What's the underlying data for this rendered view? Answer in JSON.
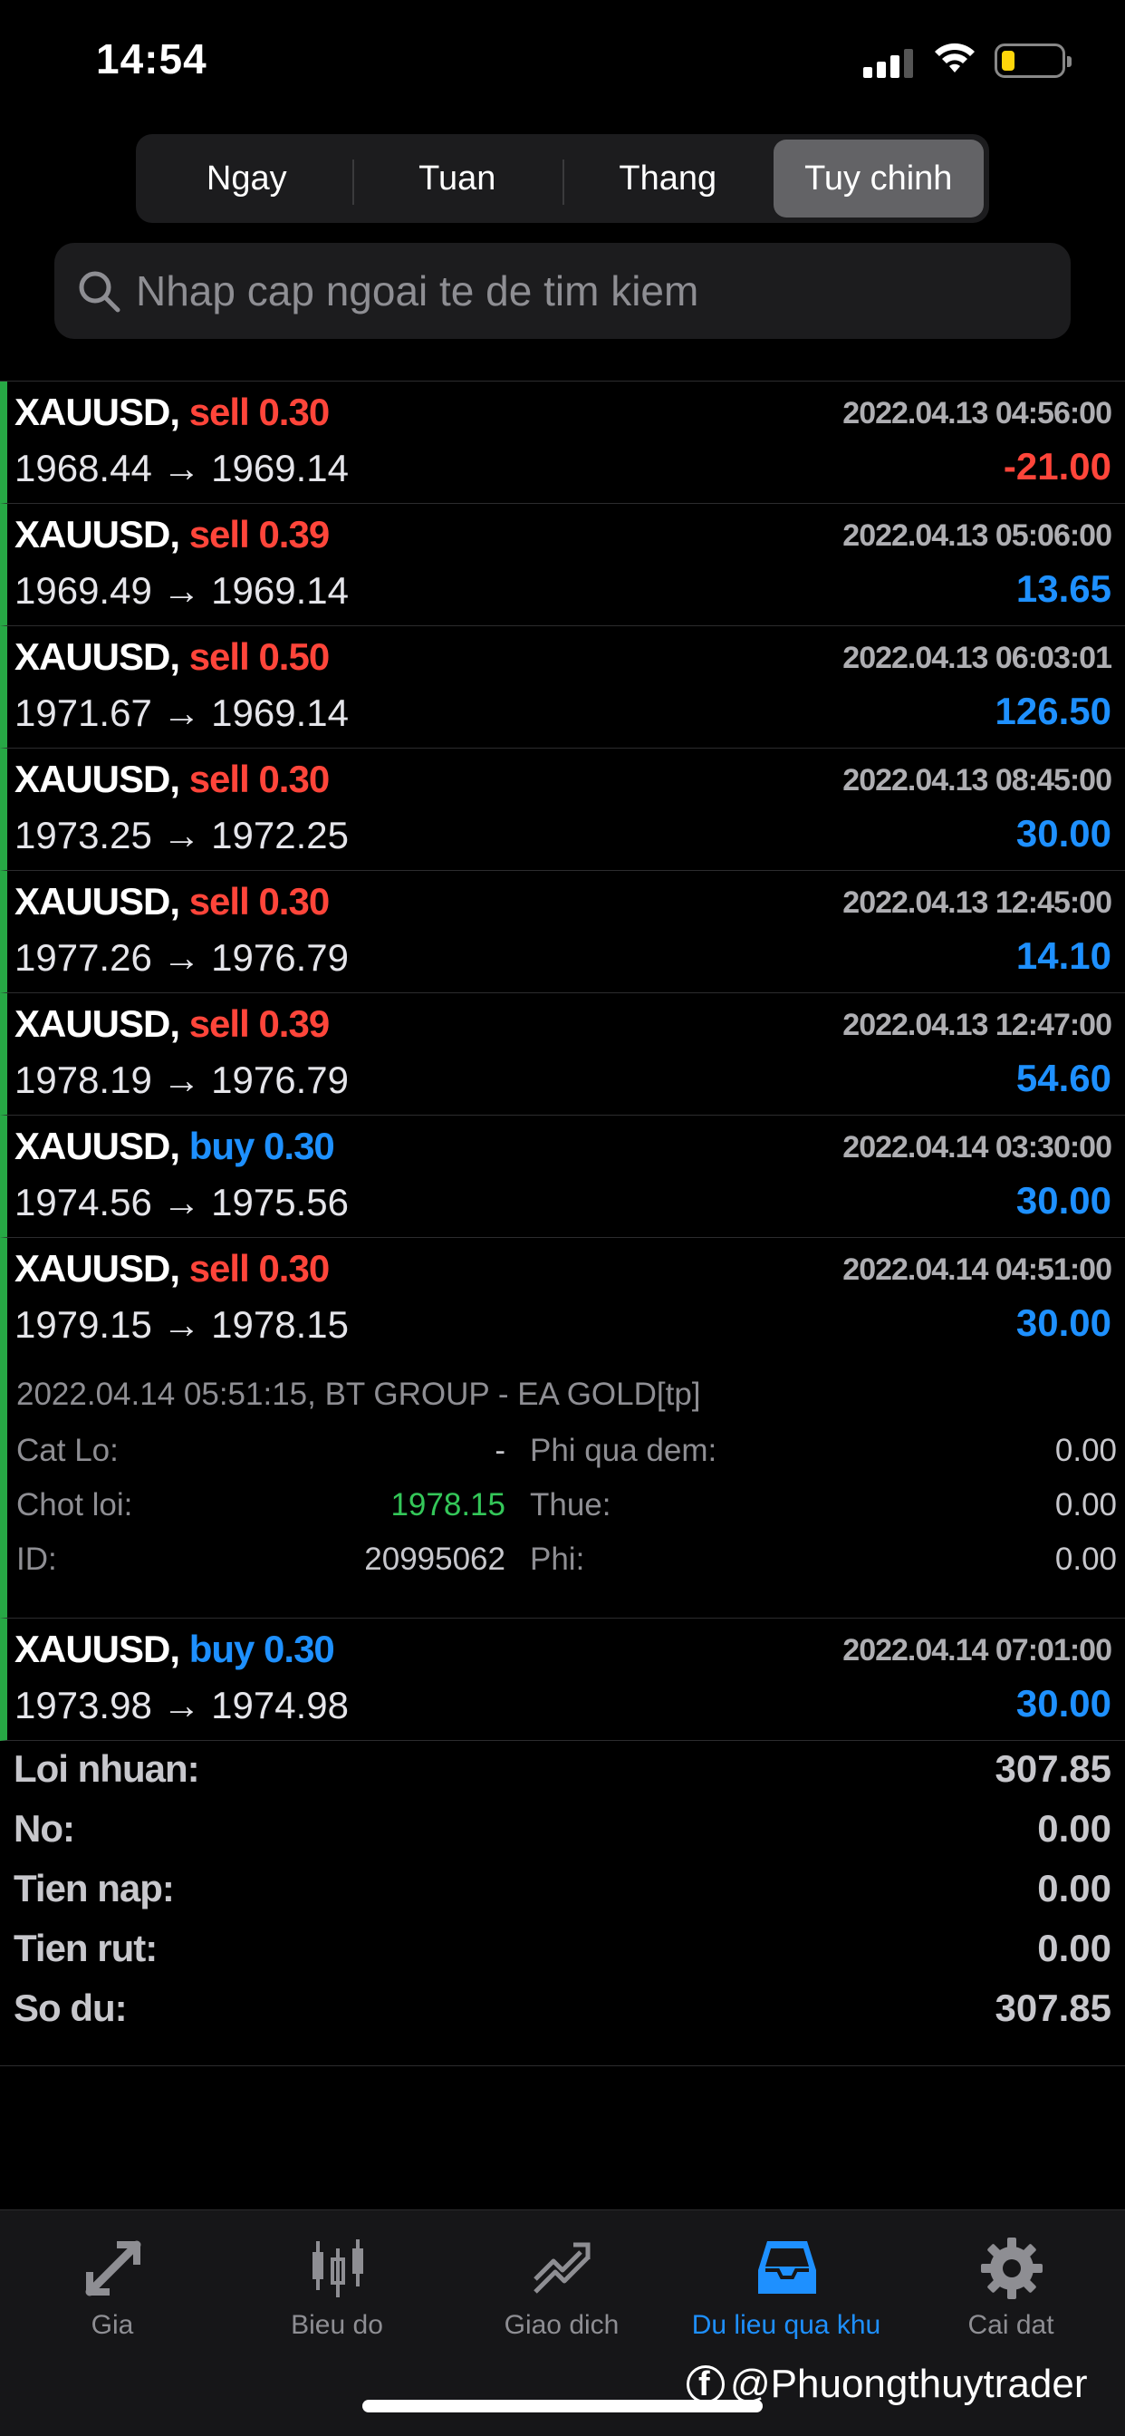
{
  "status_bar": {
    "time": "14:54"
  },
  "segments": [
    {
      "label": "Ngay",
      "active": false
    },
    {
      "label": "Tuan",
      "active": false
    },
    {
      "label": "Thang",
      "active": false
    },
    {
      "label": "Tuy chinh",
      "active": true
    }
  ],
  "search": {
    "placeholder": "Nhap cap ngoai te de tim kiem"
  },
  "trades": [
    {
      "symbol": "XAUUSD,",
      "side": "sell",
      "volume": "0.30",
      "datetime": "2022.04.13 04:56:00",
      "prices": "1968.44 → 1969.14",
      "profit": "-21.00"
    },
    {
      "symbol": "XAUUSD,",
      "side": "sell",
      "volume": "0.39",
      "datetime": "2022.04.13 05:06:00",
      "prices": "1969.49 → 1969.14",
      "profit": "13.65"
    },
    {
      "symbol": "XAUUSD,",
      "side": "sell",
      "volume": "0.50",
      "datetime": "2022.04.13 06:03:01",
      "prices": "1971.67 → 1969.14",
      "profit": "126.50"
    },
    {
      "symbol": "XAUUSD,",
      "side": "sell",
      "volume": "0.30",
      "datetime": "2022.04.13 08:45:00",
      "prices": "1973.25 → 1972.25",
      "profit": "30.00"
    },
    {
      "symbol": "XAUUSD,",
      "side": "sell",
      "volume": "0.30",
      "datetime": "2022.04.13 12:45:00",
      "prices": "1977.26 → 1976.79",
      "profit": "14.10"
    },
    {
      "symbol": "XAUUSD,",
      "side": "sell",
      "volume": "0.39",
      "datetime": "2022.04.13 12:47:00",
      "prices": "1978.19 → 1976.79",
      "profit": "54.60"
    },
    {
      "symbol": "XAUUSD,",
      "side": "buy",
      "volume": "0.30",
      "datetime": "2022.04.14 03:30:00",
      "prices": "1974.56 → 1975.56",
      "profit": "30.00"
    },
    {
      "symbol": "XAUUSD,",
      "side": "sell",
      "volume": "0.30",
      "datetime": "2022.04.14 04:51:00",
      "prices": "1979.15 → 1978.15",
      "profit": "30.00",
      "details": {
        "line1": "2022.04.14 05:51:15, BT GROUP - EA GOLD[tp]",
        "cat_lo_label": "Cat Lo:",
        "cat_lo_value": "-",
        "chot_loi_label": "Chot loi:",
        "chot_loi_value": "1978.15",
        "id_label": "ID:",
        "id_value": "20995062",
        "phi_qua_dem_label": "Phi qua dem:",
        "phi_qua_dem_value": "0.00",
        "thue_label": "Thue:",
        "thue_value": "0.00",
        "phi_label": "Phi:",
        "phi_value": "0.00"
      }
    },
    {
      "symbol": "XAUUSD,",
      "side": "buy",
      "volume": "0.30",
      "datetime": "2022.04.14 07:01:00",
      "prices": "1973.98 → 1974.98",
      "profit": "30.00"
    }
  ],
  "summary": [
    {
      "label": "Loi nhuan:",
      "value": "307.85"
    },
    {
      "label": "No:",
      "value": "0.00"
    },
    {
      "label": "Tien nap:",
      "value": "0.00"
    },
    {
      "label": "Tien rut:",
      "value": "0.00"
    },
    {
      "label": "So du:",
      "value": "307.85"
    }
  ],
  "tabbar": [
    {
      "label": "Gia",
      "icon": "quotes-arrows-icon",
      "active": false
    },
    {
      "label": "Bieu do",
      "icon": "candlestick-chart-icon",
      "active": false
    },
    {
      "label": "Giao dich",
      "icon": "trade-chart-icon",
      "active": false
    },
    {
      "label": "Du lieu qua khu",
      "icon": "history-inbox-icon",
      "active": true
    },
    {
      "label": "Cai dat",
      "icon": "gear-icon",
      "active": false
    }
  ],
  "watermark": "@Phuongthuytrader",
  "colors": {
    "sell": "#ff453a",
    "buy": "#1e90ff",
    "loss": "#ff453a",
    "profit": "#1e90ff",
    "take_profit": "#34c759",
    "active_tab": "#1e90ff",
    "row_marker": "#27a845"
  }
}
